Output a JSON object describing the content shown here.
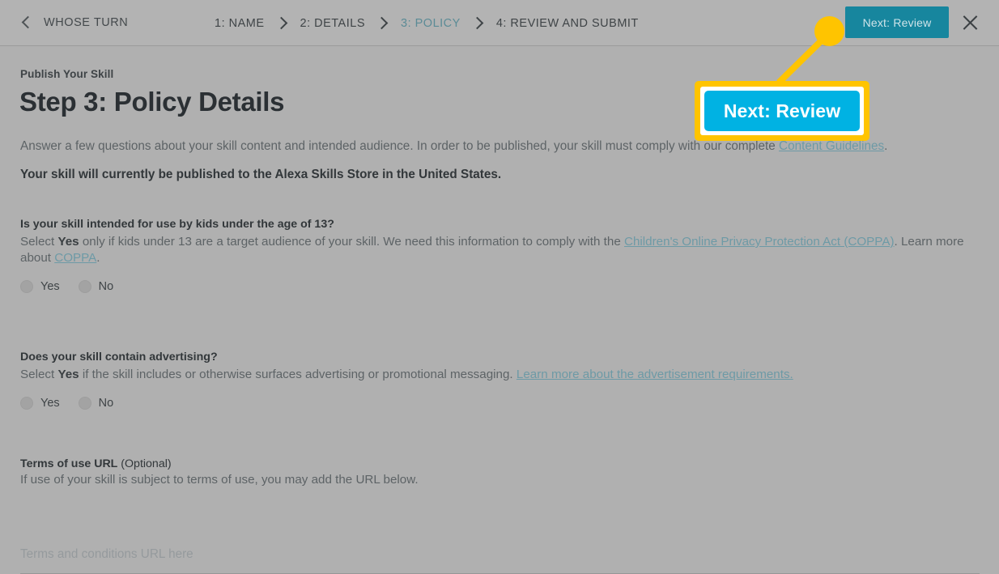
{
  "header": {
    "back_label": "WHOSE TURN",
    "back_icon": "chevron-left-icon",
    "close_icon": "close-icon",
    "steps": [
      {
        "label": "1: NAME",
        "active": false
      },
      {
        "label": "2: DETAILS",
        "active": false
      },
      {
        "label": "3: POLICY",
        "active": true
      },
      {
        "label": "4: REVIEW AND SUBMIT",
        "active": false
      }
    ],
    "next_button_label": "Next: Review",
    "next_button_color": "#17869e",
    "active_step_color": "#5b8b96"
  },
  "main": {
    "eyebrow": "Publish Your Skill",
    "title": "Step 3: Policy Details",
    "intro_before": "Answer a few questions about your skill content and intended audience. In order to be published, your skill must comply with our complete ",
    "intro_link": "Content Guidelines",
    "intro_after": ".",
    "bold_note": "Your skill will currently be published to the Alexa Skills Store in the United States.",
    "questions": [
      {
        "title": "Is your skill intended for use by kids under the age of 13?",
        "desc_1": "Select ",
        "desc_bold": "Yes",
        "desc_2": " only if kids under 13 are a target audience of your skill. We need this information to comply with the ",
        "desc_link_1": "Children's Online Privacy Protection Act (COPPA)",
        "desc_3": ". Learn more about ",
        "desc_link_2": "COPPA",
        "desc_4": ".",
        "options": [
          {
            "label": "Yes",
            "selected": false
          },
          {
            "label": "No",
            "selected": false
          }
        ]
      },
      {
        "title": "Does your skill contain advertising?",
        "desc_1": "Select ",
        "desc_bold": "Yes",
        "desc_2": " if the skill includes or otherwise surfaces advertising or promotional messaging. ",
        "desc_link_1": "Learn more about the advertisement requirements.",
        "desc_3": "",
        "desc_link_2": "",
        "desc_4": "",
        "options": [
          {
            "label": "Yes",
            "selected": false
          },
          {
            "label": "No",
            "selected": false
          }
        ]
      }
    ],
    "terms_field": {
      "label": "Terms of use URL",
      "optional": " (Optional)",
      "desc": "If use of your skill is subject to terms of use, you may add the URL below.",
      "placeholder": "Terms and conditions URL here",
      "value": ""
    },
    "link_color": "#6d9aa6"
  },
  "annotation": {
    "callout_button_label": "Next: Review",
    "highlight_color": "#ffc400",
    "callout_button_color": "#00b2e3"
  }
}
